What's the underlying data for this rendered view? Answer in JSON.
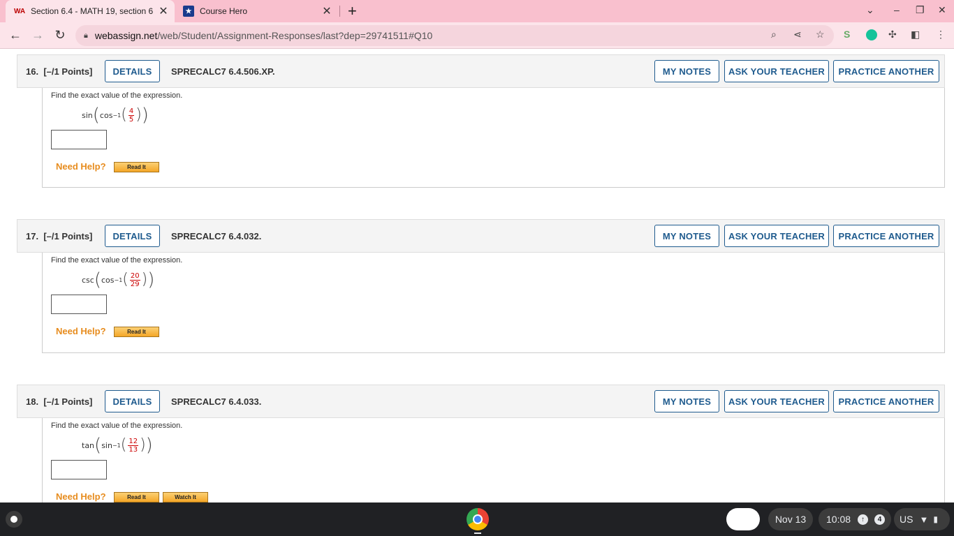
{
  "browser": {
    "tabs": [
      {
        "title": "Section 6.4 - MATH 19, section 6",
        "favicon": "WA",
        "close": "✕"
      },
      {
        "title": "Course Hero",
        "favicon": "★",
        "close": "✕"
      }
    ],
    "new_tab": "+",
    "url_host": "webassign.net",
    "url_path": "/web/Student/Assignment-Responses/last?dep=29741511#Q10"
  },
  "questions": [
    {
      "number": "16.",
      "points": "[–/1 Points]",
      "details_label": "DETAILS",
      "code": "SPRECALC7 6.4.506.XP.",
      "my_notes_label": "MY NOTES",
      "ask_label": "ASK YOUR TEACHER",
      "practice_label": "PRACTICE ANOTHER",
      "prompt": "Find the exact value of the expression.",
      "outer_fn": "sin",
      "inner_fn": "cos",
      "inverse": "−1",
      "numerator": "4",
      "denominator": "5",
      "answer": "",
      "need_help": "Need Help?",
      "help_buttons": [
        "Read It"
      ]
    },
    {
      "number": "17.",
      "points": "[–/1 Points]",
      "details_label": "DETAILS",
      "code": "SPRECALC7 6.4.032.",
      "my_notes_label": "MY NOTES",
      "ask_label": "ASK YOUR TEACHER",
      "practice_label": "PRACTICE ANOTHER",
      "prompt": "Find the exact value of the expression.",
      "outer_fn": "csc",
      "inner_fn": "cos",
      "inverse": "−1",
      "numerator": "20",
      "denominator": "29",
      "answer": "",
      "need_help": "Need Help?",
      "help_buttons": [
        "Read It"
      ]
    },
    {
      "number": "18.",
      "points": "[–/1 Points]",
      "details_label": "DETAILS",
      "code": "SPRECALC7 6.4.033.",
      "my_notes_label": "MY NOTES",
      "ask_label": "ASK YOUR TEACHER",
      "practice_label": "PRACTICE ANOTHER",
      "prompt": "Find the exact value of the expression.",
      "outer_fn": "tan",
      "inner_fn": "sin",
      "inverse": "−1",
      "numerator": "12",
      "denominator": "13",
      "answer": "",
      "need_help": "Need Help?",
      "help_buttons": [
        "Read It",
        "Watch It"
      ]
    }
  ],
  "shelf": {
    "date": "Nov 13",
    "time": "10:08",
    "notifications": "4",
    "ime": "US"
  },
  "colors": {
    "tab_strip": "#f9c0ce",
    "toolbar": "#fce4ea",
    "button_blue": "#1f5b8e",
    "help_orange": "#e78c1e",
    "fraction_red": "#cc0000"
  }
}
